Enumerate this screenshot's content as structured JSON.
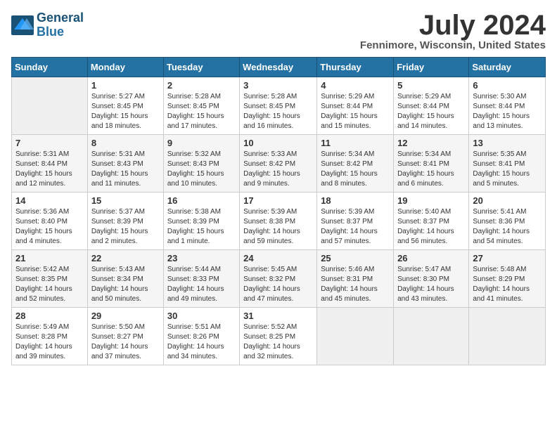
{
  "header": {
    "logo_line1": "General",
    "logo_line2": "Blue",
    "month_title": "July 2024",
    "location": "Fennimore, Wisconsin, United States"
  },
  "days_of_week": [
    "Sunday",
    "Monday",
    "Tuesday",
    "Wednesday",
    "Thursday",
    "Friday",
    "Saturday"
  ],
  "weeks": [
    [
      {
        "day": "",
        "info": ""
      },
      {
        "day": "1",
        "info": "Sunrise: 5:27 AM\nSunset: 8:45 PM\nDaylight: 15 hours\nand 18 minutes."
      },
      {
        "day": "2",
        "info": "Sunrise: 5:28 AM\nSunset: 8:45 PM\nDaylight: 15 hours\nand 17 minutes."
      },
      {
        "day": "3",
        "info": "Sunrise: 5:28 AM\nSunset: 8:45 PM\nDaylight: 15 hours\nand 16 minutes."
      },
      {
        "day": "4",
        "info": "Sunrise: 5:29 AM\nSunset: 8:44 PM\nDaylight: 15 hours\nand 15 minutes."
      },
      {
        "day": "5",
        "info": "Sunrise: 5:29 AM\nSunset: 8:44 PM\nDaylight: 15 hours\nand 14 minutes."
      },
      {
        "day": "6",
        "info": "Sunrise: 5:30 AM\nSunset: 8:44 PM\nDaylight: 15 hours\nand 13 minutes."
      }
    ],
    [
      {
        "day": "7",
        "info": "Sunrise: 5:31 AM\nSunset: 8:44 PM\nDaylight: 15 hours\nand 12 minutes."
      },
      {
        "day": "8",
        "info": "Sunrise: 5:31 AM\nSunset: 8:43 PM\nDaylight: 15 hours\nand 11 minutes."
      },
      {
        "day": "9",
        "info": "Sunrise: 5:32 AM\nSunset: 8:43 PM\nDaylight: 15 hours\nand 10 minutes."
      },
      {
        "day": "10",
        "info": "Sunrise: 5:33 AM\nSunset: 8:42 PM\nDaylight: 15 hours\nand 9 minutes."
      },
      {
        "day": "11",
        "info": "Sunrise: 5:34 AM\nSunset: 8:42 PM\nDaylight: 15 hours\nand 8 minutes."
      },
      {
        "day": "12",
        "info": "Sunrise: 5:34 AM\nSunset: 8:41 PM\nDaylight: 15 hours\nand 6 minutes."
      },
      {
        "day": "13",
        "info": "Sunrise: 5:35 AM\nSunset: 8:41 PM\nDaylight: 15 hours\nand 5 minutes."
      }
    ],
    [
      {
        "day": "14",
        "info": "Sunrise: 5:36 AM\nSunset: 8:40 PM\nDaylight: 15 hours\nand 4 minutes."
      },
      {
        "day": "15",
        "info": "Sunrise: 5:37 AM\nSunset: 8:39 PM\nDaylight: 15 hours\nand 2 minutes."
      },
      {
        "day": "16",
        "info": "Sunrise: 5:38 AM\nSunset: 8:39 PM\nDaylight: 15 hours\nand 1 minute."
      },
      {
        "day": "17",
        "info": "Sunrise: 5:39 AM\nSunset: 8:38 PM\nDaylight: 14 hours\nand 59 minutes."
      },
      {
        "day": "18",
        "info": "Sunrise: 5:39 AM\nSunset: 8:37 PM\nDaylight: 14 hours\nand 57 minutes."
      },
      {
        "day": "19",
        "info": "Sunrise: 5:40 AM\nSunset: 8:37 PM\nDaylight: 14 hours\nand 56 minutes."
      },
      {
        "day": "20",
        "info": "Sunrise: 5:41 AM\nSunset: 8:36 PM\nDaylight: 14 hours\nand 54 minutes."
      }
    ],
    [
      {
        "day": "21",
        "info": "Sunrise: 5:42 AM\nSunset: 8:35 PM\nDaylight: 14 hours\nand 52 minutes."
      },
      {
        "day": "22",
        "info": "Sunrise: 5:43 AM\nSunset: 8:34 PM\nDaylight: 14 hours\nand 50 minutes."
      },
      {
        "day": "23",
        "info": "Sunrise: 5:44 AM\nSunset: 8:33 PM\nDaylight: 14 hours\nand 49 minutes."
      },
      {
        "day": "24",
        "info": "Sunrise: 5:45 AM\nSunset: 8:32 PM\nDaylight: 14 hours\nand 47 minutes."
      },
      {
        "day": "25",
        "info": "Sunrise: 5:46 AM\nSunset: 8:31 PM\nDaylight: 14 hours\nand 45 minutes."
      },
      {
        "day": "26",
        "info": "Sunrise: 5:47 AM\nSunset: 8:30 PM\nDaylight: 14 hours\nand 43 minutes."
      },
      {
        "day": "27",
        "info": "Sunrise: 5:48 AM\nSunset: 8:29 PM\nDaylight: 14 hours\nand 41 minutes."
      }
    ],
    [
      {
        "day": "28",
        "info": "Sunrise: 5:49 AM\nSunset: 8:28 PM\nDaylight: 14 hours\nand 39 minutes."
      },
      {
        "day": "29",
        "info": "Sunrise: 5:50 AM\nSunset: 8:27 PM\nDaylight: 14 hours\nand 37 minutes."
      },
      {
        "day": "30",
        "info": "Sunrise: 5:51 AM\nSunset: 8:26 PM\nDaylight: 14 hours\nand 34 minutes."
      },
      {
        "day": "31",
        "info": "Sunrise: 5:52 AM\nSunset: 8:25 PM\nDaylight: 14 hours\nand 32 minutes."
      },
      {
        "day": "",
        "info": ""
      },
      {
        "day": "",
        "info": ""
      },
      {
        "day": "",
        "info": ""
      }
    ]
  ]
}
